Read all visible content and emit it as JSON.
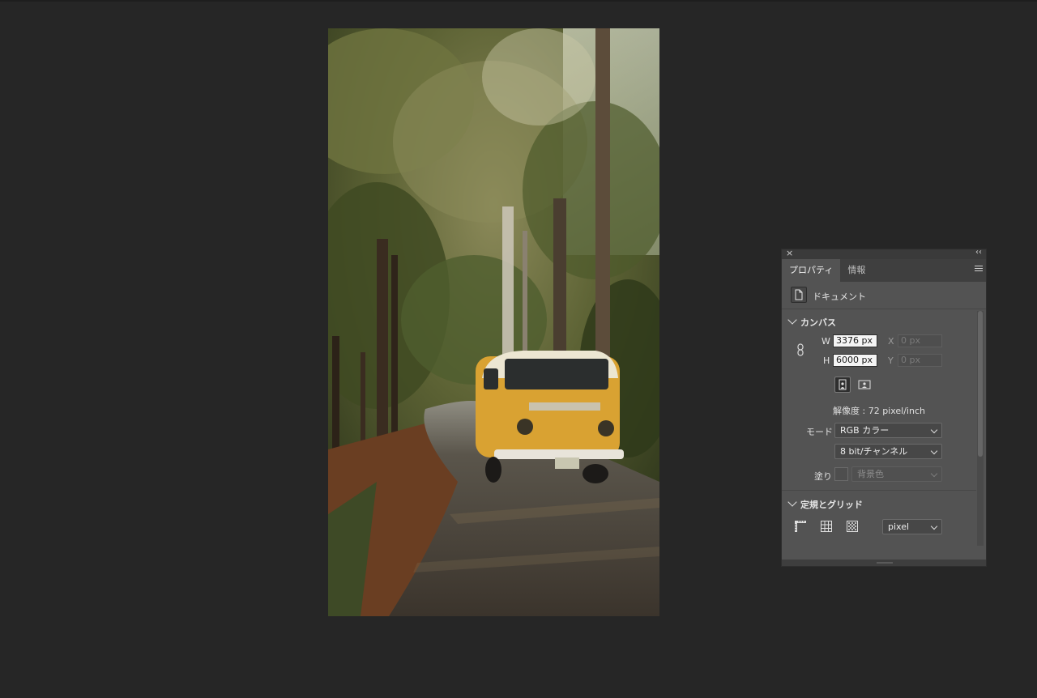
{
  "panel": {
    "close_symbol": "×",
    "collapse_symbol": "‹‹",
    "tabs": [
      {
        "label": "プロパティ",
        "active": true
      },
      {
        "label": "情報",
        "active": false
      }
    ],
    "menu_icon": "hamburger-menu-icon",
    "document_label": "ドキュメント",
    "canvas": {
      "title": "カンバス",
      "w_label": "W",
      "w_value": "3376 px",
      "h_label": "H",
      "h_value": "6000 px",
      "x_label": "X",
      "x_placeholder": "0 px",
      "y_label": "Y",
      "y_placeholder": "0 px",
      "resolution": "解像度 : 72 pixel/inch",
      "mode_label": "モード",
      "mode_value": "RGB カラー",
      "depth_value": "8 bit/チャンネル",
      "fill_label": "塗り",
      "fill_value": "背景色"
    },
    "rulers": {
      "title": "定規とグリッド",
      "unit_value": "pixel"
    }
  },
  "colors": {
    "app_background": "#262626",
    "panel_background": "#535353",
    "field_background": "#f5f5f5"
  }
}
